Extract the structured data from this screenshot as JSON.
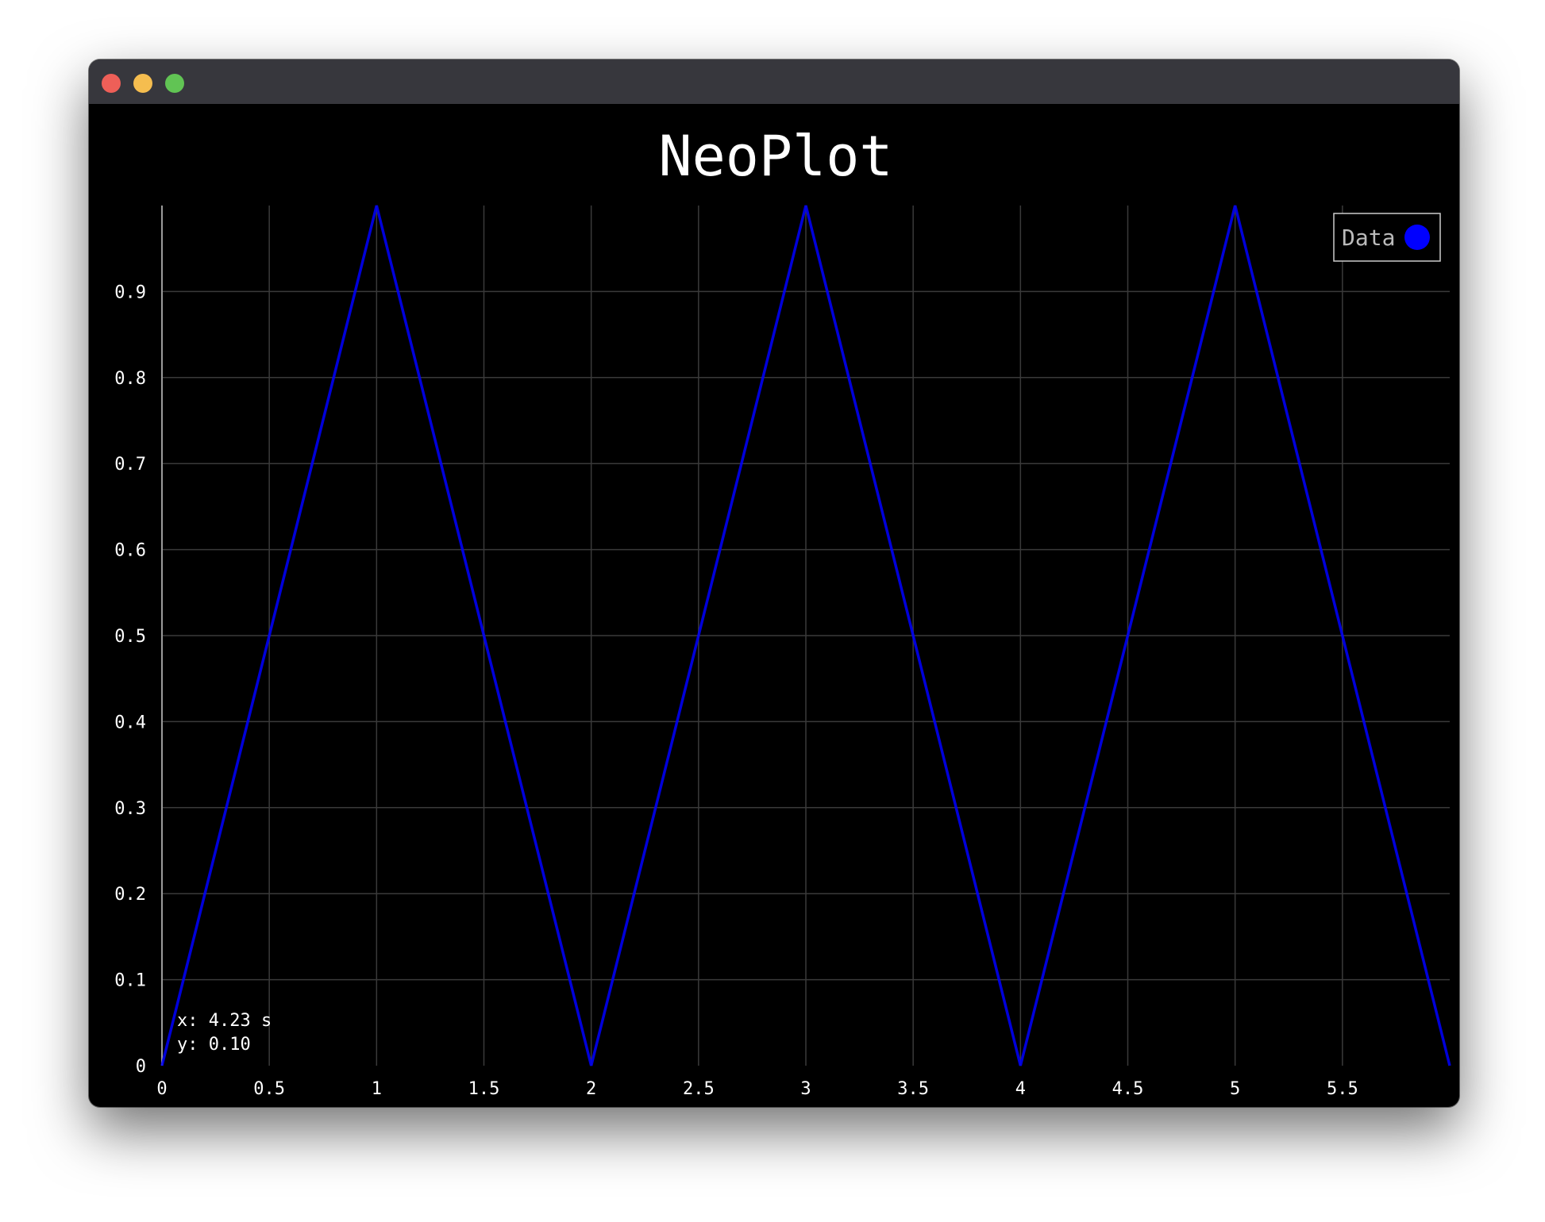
{
  "window": {
    "controls": [
      "close",
      "minimize",
      "maximize"
    ]
  },
  "chart_data": {
    "type": "line",
    "title": "NeoPlot",
    "xlabel": "",
    "ylabel": "",
    "xlim": [
      0,
      6
    ],
    "ylim": [
      0,
      1
    ],
    "x_ticks": [
      "0",
      "0.5",
      "1",
      "1.5",
      "2",
      "2.5",
      "3",
      "3.5",
      "4",
      "4.5",
      "5",
      "5.5"
    ],
    "y_ticks": [
      "0",
      "0.1",
      "0.2",
      "0.3",
      "0.4",
      "0.5",
      "0.6",
      "0.7",
      "0.8",
      "0.9"
    ],
    "grid": true,
    "legend_position": "top-right",
    "series": [
      {
        "name": "Data",
        "color": "#0000ff",
        "x": [
          0,
          1,
          2,
          3,
          4,
          5,
          6
        ],
        "y": [
          0,
          1,
          0,
          1,
          0,
          1,
          0
        ]
      }
    ],
    "cursor_readout": {
      "x_text": "x: 4.23 s",
      "y_text": "y: 0.10"
    }
  }
}
